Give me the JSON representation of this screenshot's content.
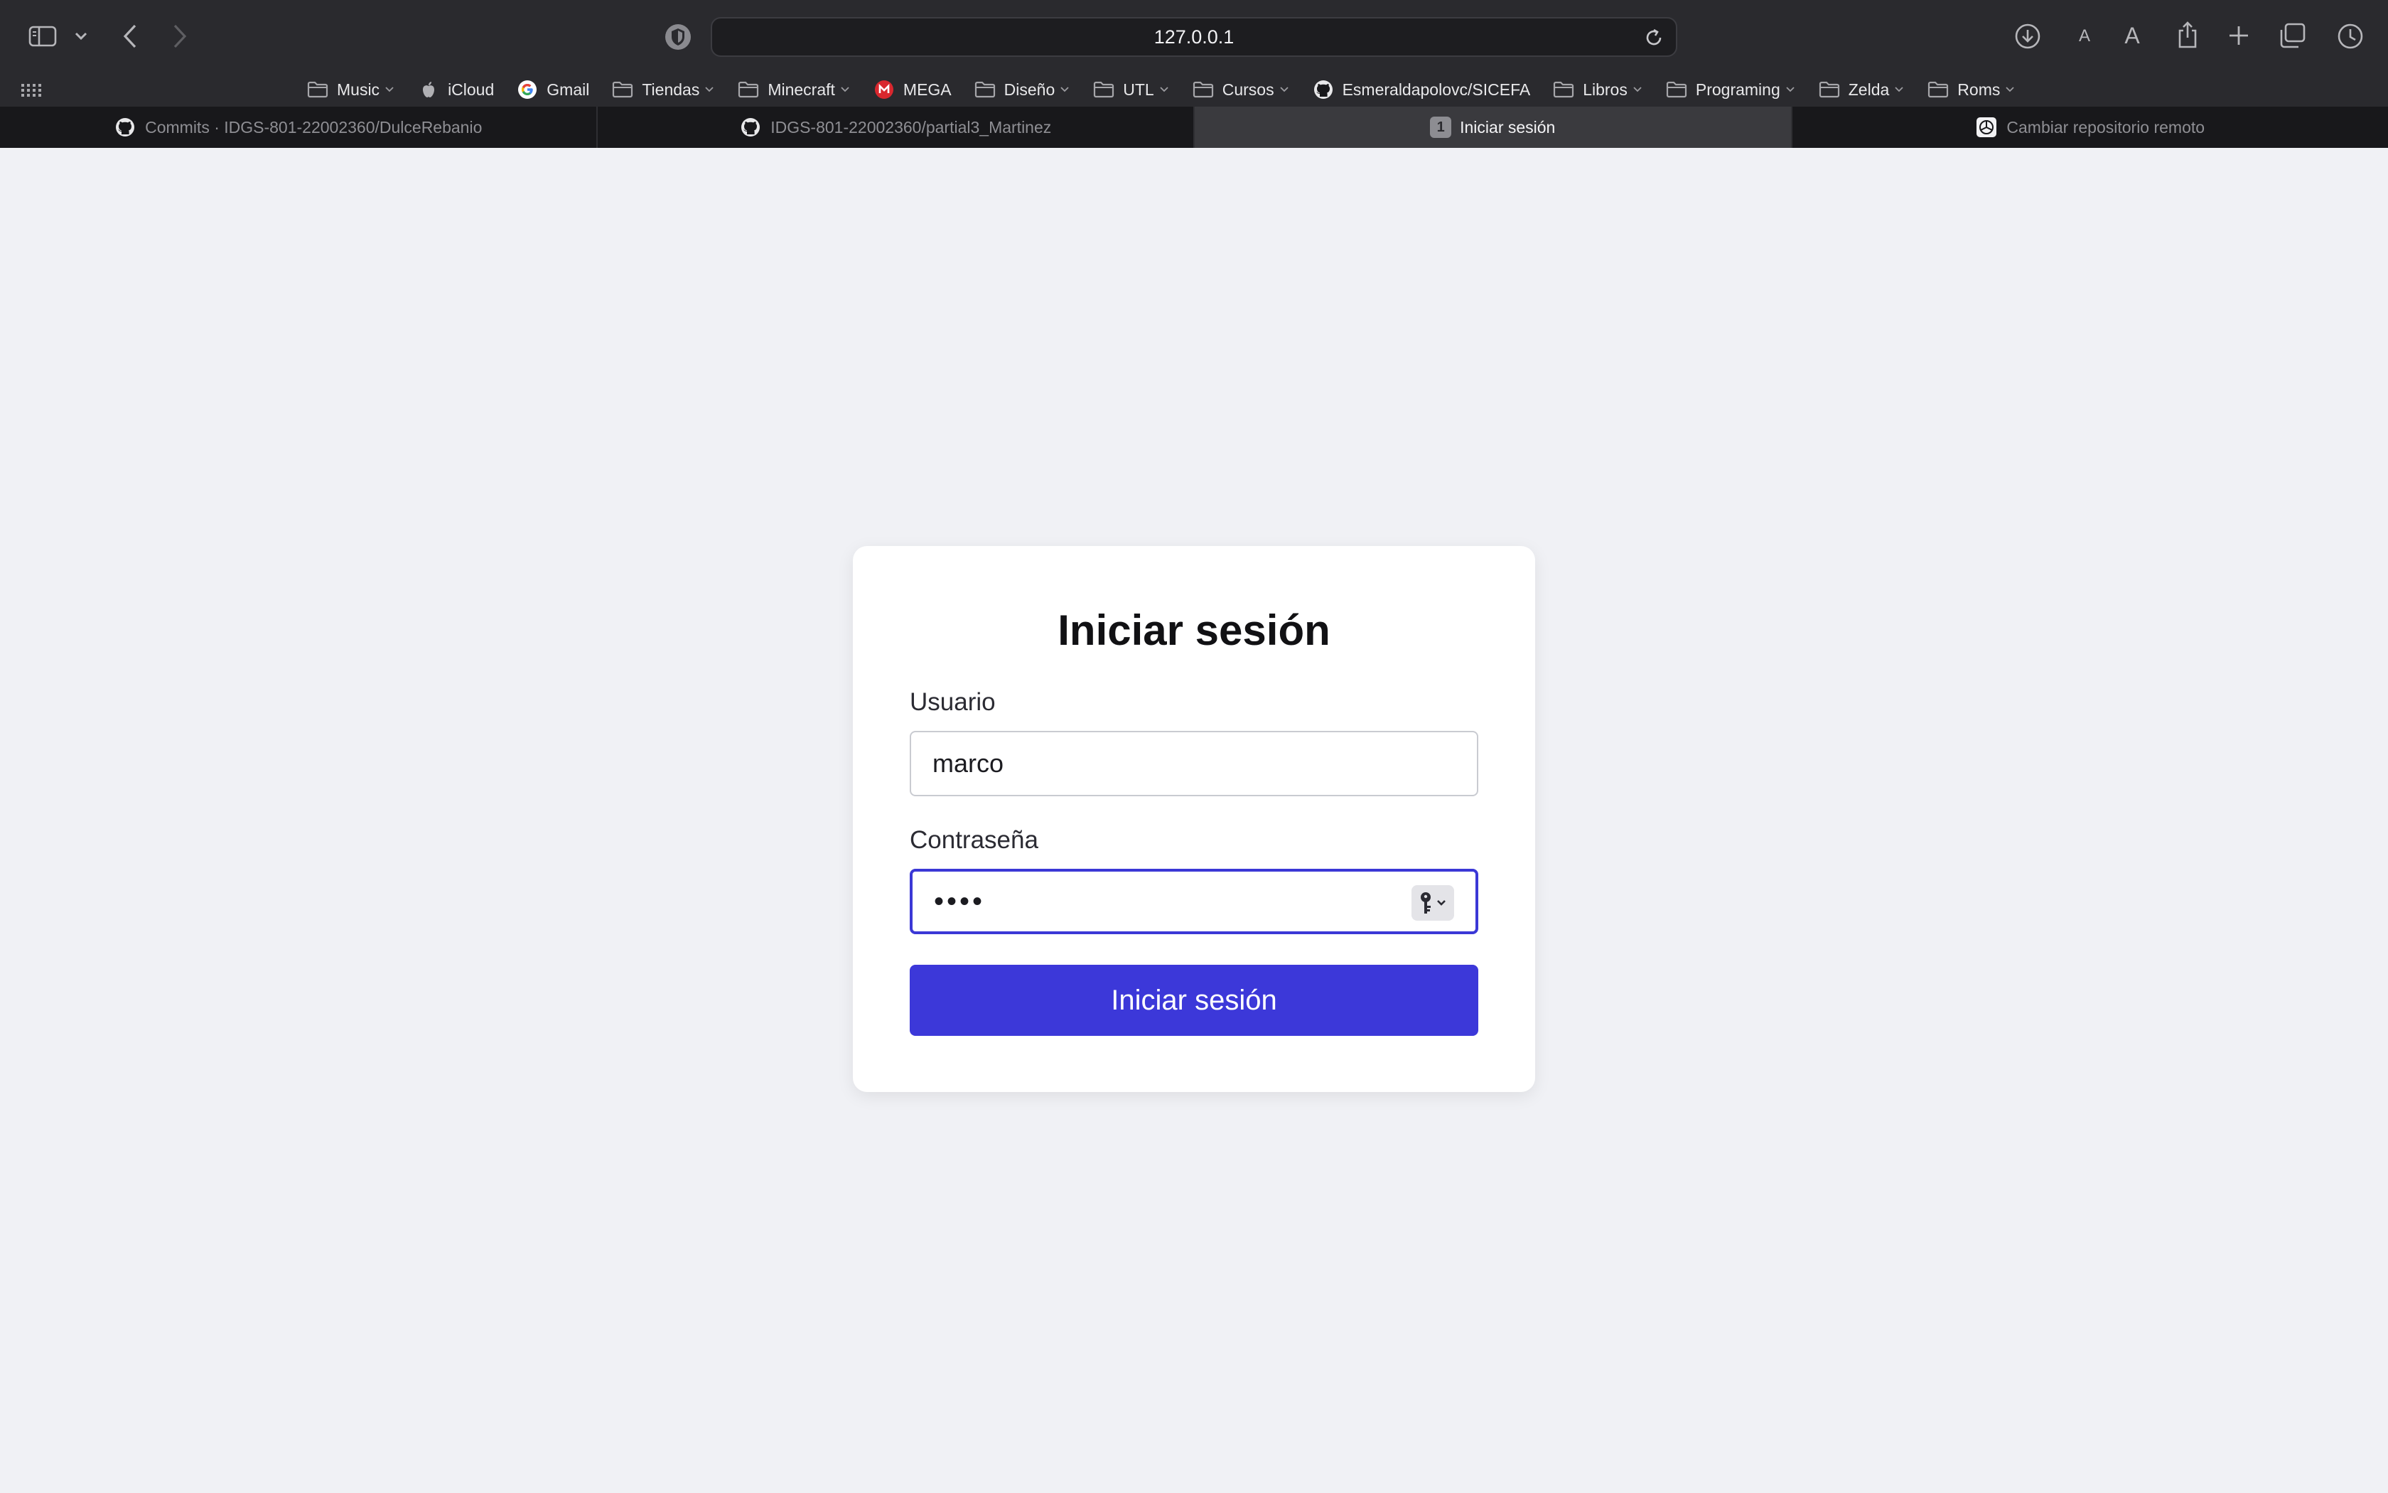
{
  "browser": {
    "address": "127.0.0.1",
    "font_small": "A",
    "font_large": "A"
  },
  "favorites": [
    {
      "label": "Music",
      "icon": "folder-icon",
      "menu": true
    },
    {
      "label": "iCloud",
      "icon": "apple-icon",
      "menu": false
    },
    {
      "label": "Gmail",
      "icon": "google-icon",
      "menu": false
    },
    {
      "label": "Tiendas",
      "icon": "folder-icon",
      "menu": true
    },
    {
      "label": "Minecraft",
      "icon": "folder-icon",
      "menu": true
    },
    {
      "label": "MEGA",
      "icon": "mega-icon",
      "menu": false
    },
    {
      "label": "Diseño",
      "icon": "folder-icon",
      "menu": true
    },
    {
      "label": "UTL",
      "icon": "folder-icon",
      "menu": true
    },
    {
      "label": "Cursos",
      "icon": "folder-icon",
      "menu": true
    },
    {
      "label": "Esmeraldapolovc/SICEFA",
      "icon": "github-icon",
      "menu": false
    },
    {
      "label": "Libros",
      "icon": "folder-icon",
      "menu": true
    },
    {
      "label": "Programing",
      "icon": "folder-icon",
      "menu": true
    },
    {
      "label": "Zelda",
      "icon": "folder-icon",
      "menu": true
    },
    {
      "label": "Roms",
      "icon": "folder-icon",
      "menu": true
    }
  ],
  "tabs": [
    {
      "title": "Commits · IDGS-801-22002360/DulceRebanio",
      "icon": "github-icon",
      "active": false
    },
    {
      "title": "IDGS-801-22002360/partial3_Martinez",
      "icon": "github-icon",
      "active": false
    },
    {
      "title": "Iniciar sesión",
      "icon": "badge",
      "badge": "1",
      "active": true
    },
    {
      "title": "Cambiar repositorio remoto",
      "icon": "chatgpt-icon",
      "active": false
    }
  ],
  "login": {
    "title": "Iniciar sesión",
    "username_label": "Usuario",
    "username_value": "marco",
    "password_label": "Contraseña",
    "password_value": "••••",
    "submit_label": "Iniciar sesión"
  },
  "colors": {
    "accent": "#3c38d9",
    "focus_border": "#3b38d6",
    "page_bg": "#f0f1f5"
  }
}
